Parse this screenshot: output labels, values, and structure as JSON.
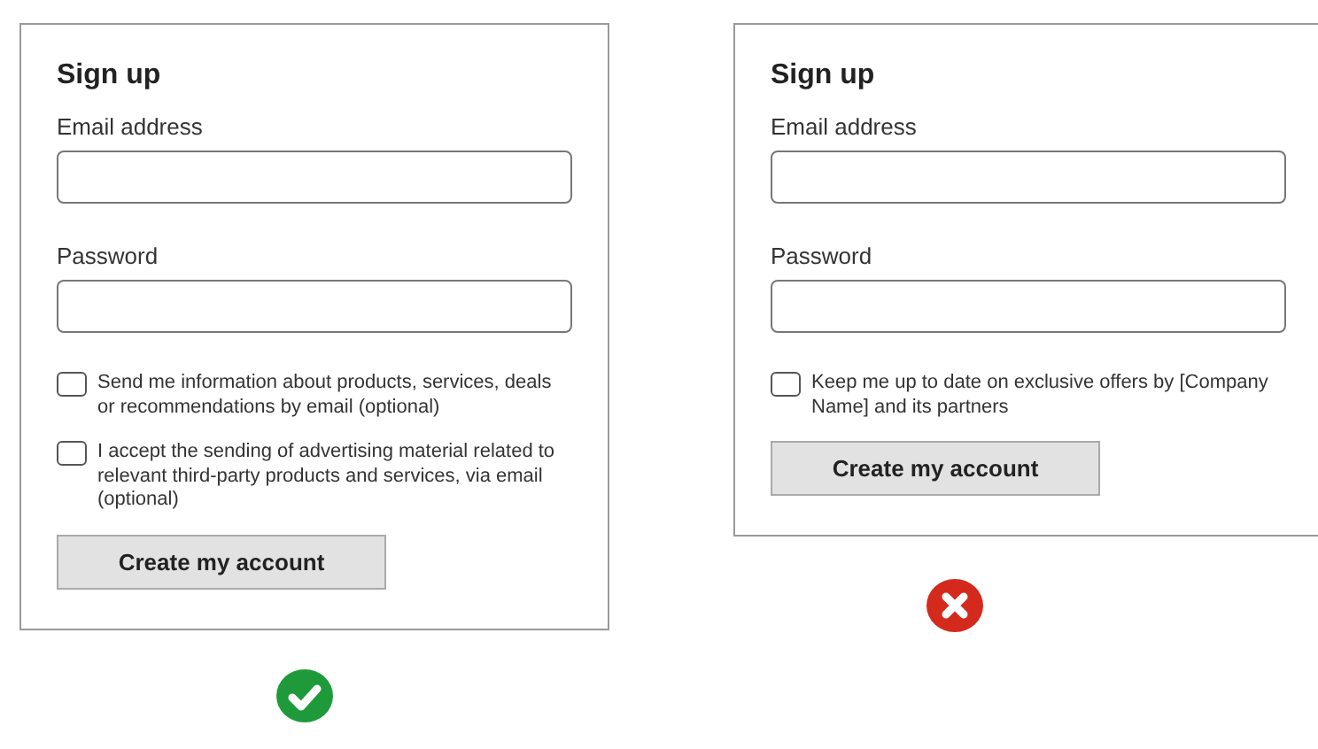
{
  "forms": [
    {
      "title": "Sign up",
      "fields": [
        {
          "label": "Email address"
        },
        {
          "label": "Password"
        }
      ],
      "options": [
        {
          "label": "Send me information about products, services, deals or recommendations by email (optional)",
          "checked": false
        },
        {
          "label": "I accept the sending of advertising material related to relevant third-party products and services, via email (optional)",
          "checked": false
        }
      ],
      "button": "Create my account",
      "verdict": {
        "kind": "good"
      }
    },
    {
      "title": "Sign up",
      "fields": [
        {
          "label": "Email address"
        },
        {
          "label": "Password"
        }
      ],
      "options": [
        {
          "label": "Keep me up to date on exclusive offers by [Company Name] and its partners",
          "checked": false
        }
      ],
      "button": "Create my account",
      "verdict": {
        "kind": "bad"
      }
    }
  ]
}
